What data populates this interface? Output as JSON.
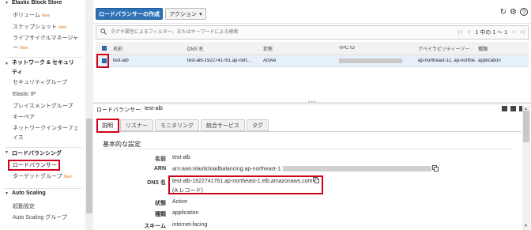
{
  "sidebar": {
    "ebs": {
      "header": "Elastic Block Store",
      "items": [
        {
          "label": "ボリューム",
          "badge": "New"
        },
        {
          "label": "スナップショット",
          "badge": "New"
        },
        {
          "label": "ライフサイクルマネージャー",
          "badge": "New"
        }
      ]
    },
    "network": {
      "header": "ネットワーク & セキュリティ",
      "items": [
        {
          "label": "セキュリティグループ",
          "badge": ""
        },
        {
          "label": "Elastic IP",
          "badge": ""
        },
        {
          "label": "プレイスメントグループ",
          "badge": ""
        },
        {
          "label": "キーペア",
          "badge": ""
        },
        {
          "label": "ネットワークインターフェイス",
          "badge": ""
        }
      ]
    },
    "lb": {
      "header": "ロードバランシング",
      "items": [
        {
          "label": "ロードバランサー",
          "badge": ""
        },
        {
          "label": "ターゲットグループ",
          "badge": "New"
        }
      ]
    },
    "as": {
      "header": "Auto Scaling",
      "items": [
        {
          "label": "起動設定",
          "badge": ""
        },
        {
          "label": "Auto Scaling グループ",
          "badge": ""
        }
      ]
    }
  },
  "toolbar": {
    "create_label": "ロードバランサーの作成",
    "action_label": "アクション",
    "action_caret": "▾",
    "refresh_icon": "↻",
    "settings_icon": "⚙",
    "help_icon": "?"
  },
  "search": {
    "placeholder": "タグや属性によるフィルター、またはキーワードによる検索",
    "pager_text": "1 中の 1 ～ 1",
    "first": "|<",
    "prev": "<",
    "next": ">",
    "last": ">|"
  },
  "table": {
    "headers": {
      "name": "名前",
      "dns": "DNS 名",
      "state": "状態",
      "vpc": "VPC ID",
      "az": "アベイラビリティーゾー",
      "type": "種類"
    },
    "rows": [
      {
        "name": "test-alb",
        "dns": "test-alb-1922741761.ap-nort...",
        "state": "Active",
        "vpc": "",
        "az": "ap-northeast-1c, ap-northeast-",
        "type": "application"
      }
    ]
  },
  "detail": {
    "title_label": "ロードバランサー:",
    "title_value": "test-alb",
    "tabs": [
      "説明",
      "リスナー",
      "モニタリング",
      "統合サービス",
      "タグ"
    ],
    "section_title": "基本的な設定",
    "fields": {
      "name": {
        "key": "名前",
        "value": "test-alb"
      },
      "arn": {
        "key": "ARN",
        "value": "arn:aws:elasticloadbalancing:ap-northeast-1:"
      },
      "dns": {
        "key": "DNS 名",
        "value": "test-alb-1922741761.ap-northeast-1.elb.amazonaws.com",
        "sub": "(A レコード)"
      },
      "state": {
        "key": "状態",
        "value": "Active"
      },
      "type": {
        "key": "種類",
        "value": "application"
      },
      "scheme": {
        "key": "スキーム",
        "value": "internet-facing"
      }
    }
  },
  "colors": {
    "primary_button": "#2e73b8",
    "selected_row": "#e6f0fb",
    "highlight": "#d0021b",
    "badge": "#e47911"
  }
}
